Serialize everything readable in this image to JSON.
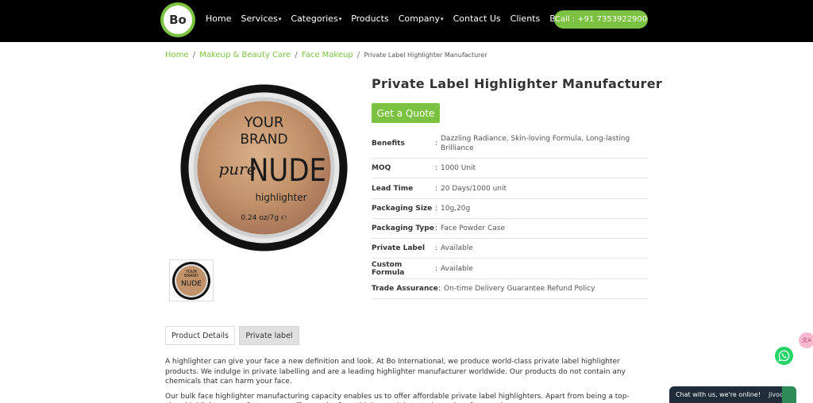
{
  "navbar": {
    "logo_text": "Bo",
    "items": [
      {
        "label": "Home",
        "dropdown": false
      },
      {
        "label": "Services",
        "dropdown": true
      },
      {
        "label": "Categories",
        "dropdown": true
      },
      {
        "label": "Products",
        "dropdown": false
      },
      {
        "label": "Company",
        "dropdown": true
      },
      {
        "label": "Contact Us",
        "dropdown": false
      },
      {
        "label": "Clients",
        "dropdown": false
      },
      {
        "label": "Blogs",
        "dropdown": true
      }
    ],
    "call_label": "Call : +91 7353922900"
  },
  "breadcrumb": {
    "home": "Home",
    "category": "Makeup & Beauty Care",
    "subcategory": "Face Makeup",
    "current": "Private Label Highlighter Manufacturer",
    "sep": "/"
  },
  "product": {
    "title": "Private Label Highlighter Manufacturer",
    "quote_label": "Get a Quote",
    "image_text": {
      "line1": "YOUR",
      "line2": "BRAND",
      "pure": "pure",
      "nude": "NUDE",
      "sub": "highlighter",
      "weight": "0.24 oz/7g ℮"
    },
    "specs": [
      {
        "label": "Benefits",
        "value": "Dazzling Radiance, Skin-loving Formula, Long-lasting Brilliance"
      },
      {
        "label": "MOQ",
        "value": "1000 Unit"
      },
      {
        "label": "Lead Time",
        "value": "20 Days/1000 unit"
      },
      {
        "label": "Packaging Size",
        "value": "10g,20g"
      },
      {
        "label": "Packaging Type",
        "value": "Face Powder Case"
      },
      {
        "label": "Private Label",
        "value": "Available"
      },
      {
        "label": "Custom Formula",
        "value": "Available"
      },
      {
        "label": "Trade Assurance",
        "value": "On-time Delivery Guarantee Refund Policy"
      }
    ]
  },
  "tabs": {
    "details": "Product Details",
    "private": "Private label"
  },
  "description": {
    "p1": "A highlighter can give your face a new definition and look. At Bo International, we produce world-class private label highlighter products. We indulge in private labelling and are a leading highlighter manufacturer worldwide. Our products do not contain any chemicals that can harm your face.",
    "p2": "Our bulk face highlighter manufacturing capacity enables us to offer affordable private label highlighters. Apart from being a top-class highlighter manufacturer, we offer cruelty-free, third-party lab-tested, paraben-free products."
  },
  "chat": {
    "label": "Chat with us, we're online!",
    "brand": "jivochat"
  },
  "widget": {
    "label": "文A"
  },
  "colors": {
    "brand_green": "#7cc242",
    "nav_bg": "#000000",
    "chat_bg": "#1f2d3a"
  }
}
